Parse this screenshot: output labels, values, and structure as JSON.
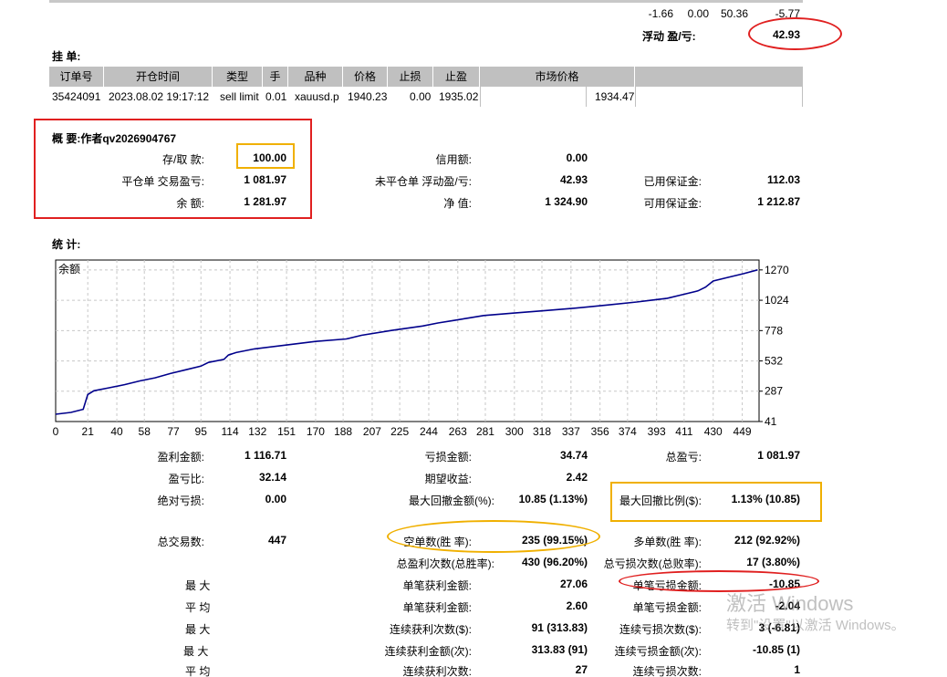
{
  "top_values": [
    "-1.66",
    "0.00",
    "50.36",
    "-5.77"
  ],
  "float_pl_label": "浮动 盈/亏:",
  "float_pl_value": "42.93",
  "pending": {
    "title": "挂 单:",
    "headers": [
      "订单号",
      "开仓时间",
      "类型",
      "手",
      "品种",
      "价格",
      "止损",
      "止盈",
      "市场价格"
    ],
    "row": [
      "35424091",
      "2023.08.02 19:17:12",
      "sell limit",
      "0.01",
      "xauusd.p",
      "1940.23",
      "0.00",
      "1935.02",
      "1934.47"
    ]
  },
  "summary": {
    "title": "概 要:作者qv2026904767",
    "deposit_label": "存/取 款:",
    "deposit_value": "100.00",
    "closed_pl_label": "平仓单 交易盈亏:",
    "closed_pl_value": "1 081.97",
    "balance_label": "余 额:",
    "balance_value": "1 281.97",
    "credit_label": "信用额:",
    "credit_value": "0.00",
    "open_pl_label": "未平仓单 浮动盈/亏:",
    "open_pl_value": "42.93",
    "equity_label": "净 值:",
    "equity_value": "1 324.90",
    "margin_label": "已用保证金:",
    "margin_value": "112.03",
    "free_margin_label": "可用保证金:",
    "free_margin_value": "1 212.87"
  },
  "stats_title": "统 计:",
  "chart_data": {
    "type": "line",
    "title": "余额",
    "x_ticks": [
      0,
      21,
      40,
      58,
      77,
      95,
      114,
      132,
      151,
      170,
      188,
      207,
      225,
      244,
      263,
      281,
      300,
      318,
      337,
      356,
      374,
      393,
      411,
      430,
      449
    ],
    "y_ticks": [
      41,
      287,
      532,
      778,
      1024,
      1270
    ],
    "xlim": [
      0,
      460
    ],
    "ylim": [
      41,
      1350
    ],
    "grid": true,
    "line_color": "#00008b",
    "x": [
      0,
      10,
      18,
      21,
      25,
      35,
      45,
      55,
      65,
      75,
      85,
      95,
      100,
      110,
      113,
      118,
      130,
      150,
      170,
      190,
      200,
      220,
      240,
      250,
      260,
      270,
      280,
      300,
      320,
      340,
      360,
      380,
      390,
      400,
      410,
      420,
      425,
      430,
      440,
      450,
      459
    ],
    "y": [
      100,
      115,
      140,
      260,
      290,
      315,
      340,
      370,
      395,
      430,
      460,
      490,
      520,
      545,
      580,
      600,
      630,
      660,
      690,
      710,
      740,
      780,
      815,
      840,
      860,
      880,
      900,
      920,
      940,
      960,
      985,
      1010,
      1025,
      1040,
      1070,
      1100,
      1130,
      1180,
      1210,
      1240,
      1270
    ]
  },
  "stats": {
    "gross_profit_label": "盈利金额:",
    "gross_profit_value": "1 116.71",
    "gross_loss_label": "亏损金额:",
    "gross_loss_value": "34.74",
    "total_net_label": "总盈亏:",
    "total_net_value": "1 081.97",
    "profit_factor_label": "盈亏比:",
    "profit_factor_value": "32.14",
    "expected_label": "期望收益:",
    "expected_value": "2.42",
    "abs_dd_label": "绝对亏损:",
    "abs_dd_value": "0.00",
    "max_dd_label": "最大回撤金额(%):",
    "max_dd_value": "10.85 (1.13%)",
    "rel_dd_label": "最大回撤比例($):",
    "rel_dd_value": "1.13% (10.85)",
    "total_trades_label": "总交易数:",
    "total_trades_value": "447",
    "short_label": "空单数(胜 率):",
    "short_value": "235 (99.15%)",
    "long_label": "多单数(胜 率):",
    "long_value": "212 (92.92%)",
    "profit_trades_label": "总盈利次数(总胜率):",
    "profit_trades_value": "430 (96.20%)",
    "loss_trades_label": "总亏损次数(总败率):",
    "loss_trades_value": "17 (3.80%)",
    "max1_label": "最 大",
    "largest_profit_label": "单笔获利金额:",
    "largest_profit_value": "27.06",
    "largest_loss_label": "单笔亏损金额:",
    "largest_loss_value": "-10.85",
    "avg1_label": "平 均",
    "avg_profit_label": "单笔获利金额:",
    "avg_profit_value": "2.60",
    "avg_loss_label": "单笔亏损金额:",
    "avg_loss_value": "-2.04",
    "max2_label": "最 大",
    "max_cons_wins_label": "连续获利次数($):",
    "max_cons_wins_value": "91 (313.83)",
    "max_cons_losses_label": "连续亏损次数($):",
    "max_cons_losses_value": "3 (-6.81)",
    "max3_label": "最 大",
    "max_cons_profit_label": "连续获利金额(次):",
    "max_cons_profit_value": "313.83 (91)",
    "max_cons_loss_label": "连续亏损金额(次):",
    "max_cons_loss_value": "-10.85 (1)",
    "avg2_label": "平 均",
    "avg_cons_wins_label": "连续获利次数:",
    "avg_cons_wins_value": "27",
    "avg_cons_losses_label": "连续亏损次数:",
    "avg_cons_losses_value": "1"
  },
  "watermark": {
    "line1": "激活 Windows",
    "line2": "转到\"设置\"以激活 Windows。"
  },
  "colors": {
    "red_annotation": "#e02020",
    "yellow_annotation": "#f0b000",
    "header_gray": "#c0c0c0"
  }
}
